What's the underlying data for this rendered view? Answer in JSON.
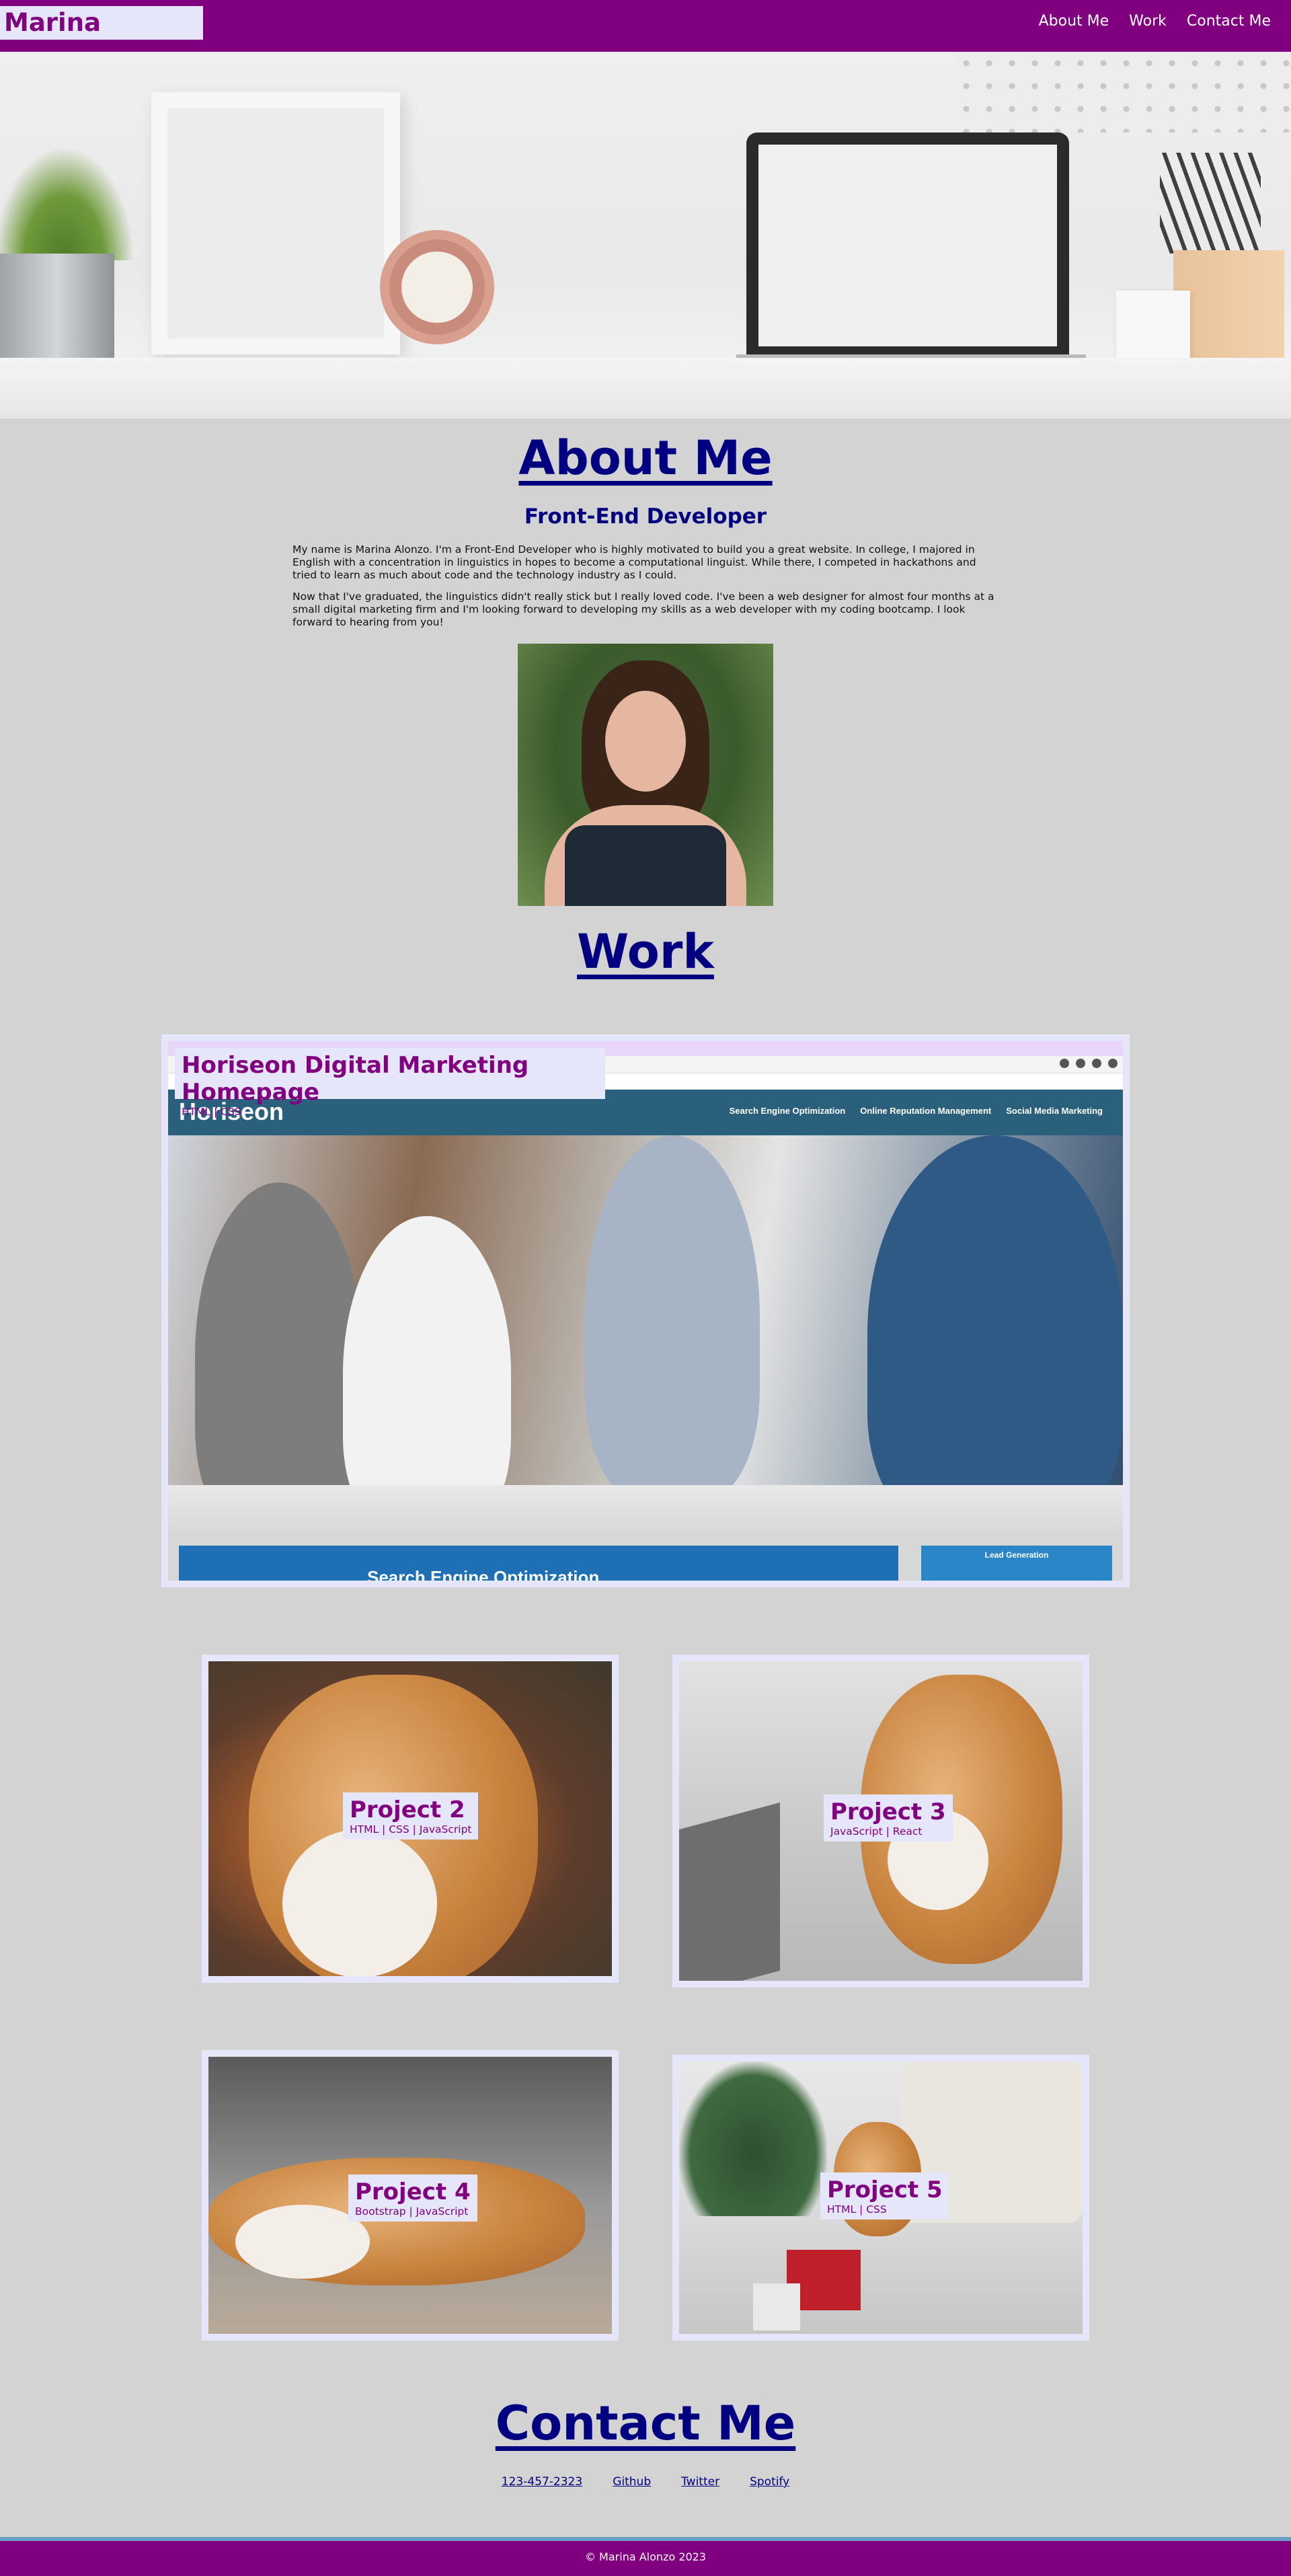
{
  "header": {
    "brand": "Marina Alonzo",
    "nav": [
      "About Me",
      "Work",
      "Contact Me"
    ]
  },
  "about": {
    "title": "About Me",
    "subtitle": "Front-End Developer",
    "paragraphs": [
      "My name is Marina Alonzo. I'm a Front-End Developer who is highly motivated to build you a great website. In college, I majored in English with a concentration in linguistics in hopes to become a computational linguist. While there, I competed in hackathons and tried to learn as much about code and the technology industry as I could.",
      "Now that I've graduated, the linguistics didn't really stick but I really loved code. I've been a web designer for almost four months at a small digital marketing firm and I'm looking forward to developing my skills as a web developer with my coding bootcamp. I look forward to hearing from you!"
    ]
  },
  "work": {
    "title": "Work",
    "featured": {
      "title": "Horiseon Digital Marketing Homepage",
      "tech": "HTML | CSS",
      "screenshot": {
        "logo": "Horiseon",
        "nav": [
          "Search Engine Optimization",
          "Online Reputation Management",
          "Social Media Marketing"
        ],
        "banner": "Search Engine Optimization",
        "side_button": "Lead Generation"
      }
    },
    "projects": [
      {
        "title": "Project 2",
        "tech": "HTML | CSS | JavaScript"
      },
      {
        "title": "Project 3",
        "tech": "JavaScript | React"
      },
      {
        "title": "Project 4",
        "tech": "Bootstrap | JavaScript"
      },
      {
        "title": "Project 5",
        "tech": "HTML | CSS"
      }
    ]
  },
  "contact": {
    "title": "Contact Me",
    "links": [
      "123-457-2323",
      "Github",
      "Twitter",
      "Spotify"
    ]
  },
  "footer": {
    "text": "© Marina Alonzo 2023"
  },
  "colors": {
    "header_bg": "#800080",
    "brand_bg": "#e6e6fa",
    "heading": "#000080",
    "page_bg": "#d3d3d3"
  }
}
